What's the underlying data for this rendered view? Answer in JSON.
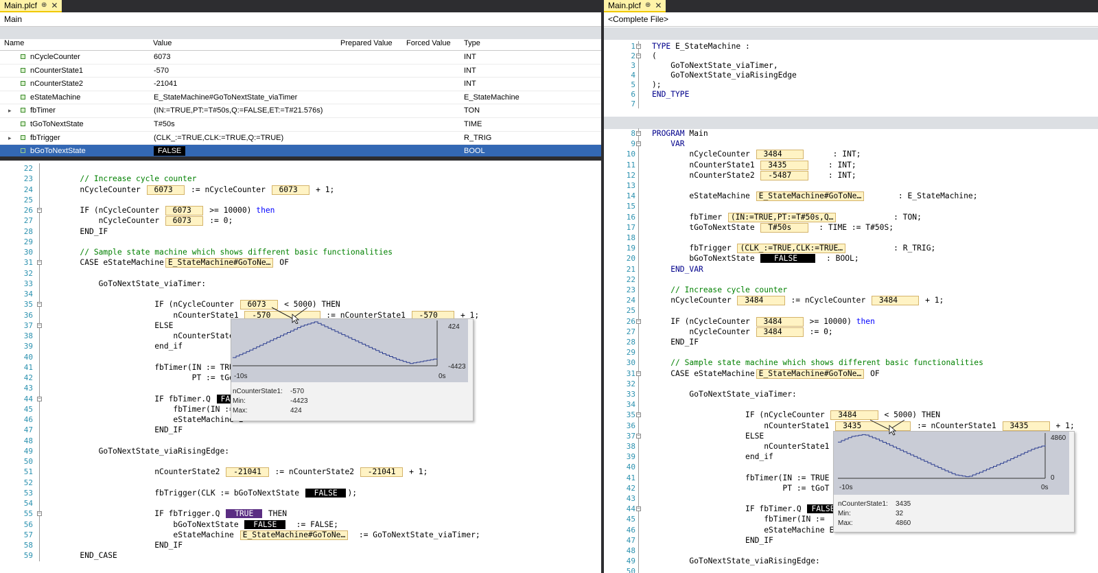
{
  "left": {
    "tab": {
      "title": "Main.plcf",
      "pin": "⊕",
      "close": "✕"
    },
    "breadcrumb": "Main",
    "watch": {
      "columns": [
        "Name",
        "Value",
        "Prepared Value",
        "Forced Value",
        "Type"
      ],
      "rows": [
        {
          "name": "nCycleCounter",
          "value": "6073",
          "type": "INT",
          "expandable": false
        },
        {
          "name": "nCounterState1",
          "value": "-570",
          "type": "INT",
          "expandable": false
        },
        {
          "name": "nCounterState2",
          "value": "-21041",
          "type": "INT",
          "expandable": false
        },
        {
          "name": "eStateMachine",
          "value": "E_StateMachine#GoToNextState_viaTimer",
          "type": "E_StateMachine",
          "expandable": false
        },
        {
          "name": "fbTimer",
          "value": "(IN:=TRUE,PT:=T#50s,Q:=FALSE,ET:=T#21.576s)",
          "type": "TON",
          "expandable": true
        },
        {
          "name": "tGoToNextState",
          "value": "T#50s",
          "type": "TIME",
          "expandable": false
        },
        {
          "name": "fbTrigger",
          "value": "(CLK_:=TRUE,CLK:=TRUE,Q:=TRUE)",
          "type": "R_TRIG",
          "expandable": true
        },
        {
          "name": "bGoToNextState",
          "value": "FALSE",
          "type": "BOOL",
          "expandable": false,
          "selected": true
        }
      ]
    },
    "code": [
      {
        "n": "22",
        "parts": []
      },
      {
        "n": "23",
        "parts": [
          {
            "c": "cm",
            "t": "        // Increase cycle counter"
          }
        ]
      },
      {
        "n": "24",
        "parts": [
          {
            "t": "        nCycleCounter "
          },
          {
            "c": "iv",
            "t": " 6073  "
          },
          {
            "t": " := nCycleCounter "
          },
          {
            "c": "iv",
            "t": " 6073  "
          },
          {
            "t": " + 1;"
          }
        ]
      },
      {
        "n": "25",
        "parts": []
      },
      {
        "n": "26",
        "fold": "-",
        "parts": [
          {
            "t": "        IF (nCycleCounter "
          },
          {
            "c": "iv",
            "t": " 6073  "
          },
          {
            "t": " >= 10000) "
          },
          {
            "c": "kw",
            "t": "then"
          }
        ]
      },
      {
        "n": "27",
        "parts": [
          {
            "t": "            nCycleCounter "
          },
          {
            "c": "iv",
            "t": " 6073  "
          },
          {
            "t": " := 0;"
          }
        ]
      },
      {
        "n": "28",
        "parts": [
          {
            "t": "        END_IF"
          }
        ]
      },
      {
        "n": "29",
        "parts": []
      },
      {
        "n": "30",
        "parts": [
          {
            "c": "cm",
            "t": "        // Sample state machine which shows different basic functionalities"
          }
        ]
      },
      {
        "n": "31",
        "fold": "-",
        "parts": [
          {
            "t": "        CASE eStateMachine"
          },
          {
            "c": "iv",
            "t": "E_StateMachine#GoToNe…"
          },
          {
            "t": " OF"
          }
        ]
      },
      {
        "n": "32",
        "parts": []
      },
      {
        "n": "33",
        "parts": [
          {
            "t": "            GoToNextState_viaTimer:"
          }
        ]
      },
      {
        "n": "34",
        "parts": []
      },
      {
        "n": "35",
        "fold": "-",
        "parts": [
          {
            "t": "                        IF (nCycleCounter "
          },
          {
            "c": "iv",
            "t": " 6073  "
          },
          {
            "t": " < 5000) THEN"
          }
        ]
      },
      {
        "n": "36",
        "parts": [
          {
            "t": "                            nCounterState1 "
          },
          {
            "c": "iv",
            "t": " -570          "
          },
          {
            "t": " := nCounterState1 "
          },
          {
            "c": "iv",
            "t": " -570   "
          },
          {
            "t": " + 1;"
          }
        ]
      },
      {
        "n": "37",
        "fold": "-",
        "parts": [
          {
            "t": "                        ELSE"
          }
        ]
      },
      {
        "n": "38",
        "parts": [
          {
            "t": "                            nCounterState1"
          }
        ]
      },
      {
        "n": "39",
        "parts": [
          {
            "t": "                        end_if"
          }
        ]
      },
      {
        "n": "40",
        "parts": []
      },
      {
        "n": "41",
        "parts": [
          {
            "t": "                        fbTimer(IN := TRUE"
          }
        ]
      },
      {
        "n": "42",
        "parts": [
          {
            "t": "                                PT := tGoT"
          }
        ]
      },
      {
        "n": "43",
        "parts": []
      },
      {
        "n": "44",
        "fold": "-",
        "parts": [
          {
            "t": "                        IF fbTimer.Q "
          },
          {
            "c": "ivb",
            "t": "FALSE"
          }
        ]
      },
      {
        "n": "45",
        "parts": [
          {
            "t": "                            fbTimer(IN :="
          }
        ]
      },
      {
        "n": "46",
        "parts": [
          {
            "t": "                            eStateMachine E"
          }
        ]
      },
      {
        "n": "47",
        "parts": [
          {
            "t": "                        END_IF"
          }
        ]
      },
      {
        "n": "48",
        "parts": []
      },
      {
        "n": "49",
        "parts": [
          {
            "t": "            GoToNextState_viaRisingEdge:"
          }
        ]
      },
      {
        "n": "50",
        "parts": []
      },
      {
        "n": "51",
        "parts": [
          {
            "t": "                        nCounterState2 "
          },
          {
            "c": "iv",
            "t": " -21041 "
          },
          {
            "t": " := nCounterState2 "
          },
          {
            "c": "iv",
            "t": " -21041 "
          },
          {
            "t": " + 1;"
          }
        ]
      },
      {
        "n": "52",
        "parts": []
      },
      {
        "n": "53",
        "parts": [
          {
            "t": "                        fbTrigger(CLK := bGoToNextState "
          },
          {
            "c": "ivb",
            "t": " FALSE "
          },
          {
            "t": ");"
          }
        ]
      },
      {
        "n": "54",
        "parts": []
      },
      {
        "n": "55",
        "fold": "-",
        "parts": [
          {
            "t": "                        IF fbTrigger.Q "
          },
          {
            "c": "ivp",
            "t": " TRUE "
          },
          {
            "t": " THEN"
          }
        ]
      },
      {
        "n": "56",
        "parts": [
          {
            "t": "                            bGoToNextState "
          },
          {
            "c": "ivb",
            "t": " FALSE "
          },
          {
            "t": "  := FALSE;"
          }
        ]
      },
      {
        "n": "57",
        "parts": [
          {
            "t": "                            eStateMachine "
          },
          {
            "c": "iv",
            "t": "E_StateMachine#GoToNe…"
          },
          {
            "t": "  := GoToNextState_viaTimer;"
          }
        ]
      },
      {
        "n": "58",
        "parts": [
          {
            "t": "                        END_IF"
          }
        ]
      },
      {
        "n": "59",
        "parts": [
          {
            "t": "        END_CASE"
          }
        ]
      }
    ],
    "tooltip": {
      "max_label": "424",
      "min_label": "-4423",
      "x_left": "-10s",
      "x_right": "0s",
      "name_label": "nCounterState1:",
      "name_value": "-570",
      "min_text": "Min:",
      "min_value": "-4423",
      "max_text": "Max:",
      "max_value": "424",
      "trace": [
        0.16,
        0.3,
        0.45,
        0.6,
        0.75,
        0.9,
        1.0,
        0.85,
        0.7,
        0.55,
        0.4,
        0.25,
        0.12,
        0.02,
        0.08,
        0.14
      ]
    }
  },
  "right": {
    "tab": {
      "title": "Main.plcf",
      "pin": "⊕",
      "close": "✕"
    },
    "breadcrumb": "<Complete File>",
    "code_a": [
      {
        "n": "1",
        "fold": "-",
        "parts": [
          {
            "c": "kwb",
            "t": "TYPE"
          },
          {
            "t": " E_StateMachine :"
          }
        ]
      },
      {
        "n": "2",
        "fold": "-",
        "parts": [
          {
            "t": "("
          }
        ]
      },
      {
        "n": "3",
        "parts": [
          {
            "t": "    GoToNextState_viaTimer,"
          }
        ]
      },
      {
        "n": "4",
        "parts": [
          {
            "t": "    GoToNextState_viaRisingEdge"
          }
        ]
      },
      {
        "n": "5",
        "parts": [
          {
            "t": ");"
          }
        ]
      },
      {
        "n": "6",
        "parts": [
          {
            "c": "kwb",
            "t": "END_TYPE"
          }
        ]
      },
      {
        "n": "7",
        "parts": []
      }
    ],
    "code_b": [
      {
        "n": "8",
        "fold": "-",
        "parts": [
          {
            "c": "kwb",
            "t": "PROGRAM"
          },
          {
            "t": " Main"
          }
        ]
      },
      {
        "n": "9",
        "fold": "-",
        "parts": [
          {
            "c": "kwb",
            "t": "    VAR"
          }
        ]
      },
      {
        "n": "10",
        "parts": [
          {
            "t": "        nCycleCounter "
          },
          {
            "c": "iv",
            "t": " 3484    "
          },
          {
            "t": "      : INT;"
          }
        ]
      },
      {
        "n": "11",
        "parts": [
          {
            "t": "        nCounterState1 "
          },
          {
            "c": "iv",
            "t": " 3435    "
          },
          {
            "t": "    : INT;"
          }
        ]
      },
      {
        "n": "12",
        "parts": [
          {
            "t": "        nCounterState2 "
          },
          {
            "c": "iv",
            "t": " -5487   "
          },
          {
            "t": "    : INT;"
          }
        ]
      },
      {
        "n": "13",
        "parts": []
      },
      {
        "n": "14",
        "parts": [
          {
            "t": "        eStateMachine "
          },
          {
            "c": "iv",
            "t": "E_StateMachine#GoToNe…"
          },
          {
            "t": "       : E_StateMachine;"
          }
        ]
      },
      {
        "n": "15",
        "parts": []
      },
      {
        "n": "16",
        "parts": [
          {
            "t": "        fbTimer "
          },
          {
            "c": "iv",
            "t": "(IN:=TRUE,PT:=T#50s,Q…"
          },
          {
            "t": "            : TON;"
          }
        ]
      },
      {
        "n": "17",
        "parts": [
          {
            "t": "        tGoToNextState "
          },
          {
            "c": "iv",
            "t": " T#50s   "
          },
          {
            "t": "  : TIME := T#50S;"
          }
        ]
      },
      {
        "n": "18",
        "parts": []
      },
      {
        "n": "19",
        "parts": [
          {
            "t": "        fbTrigger "
          },
          {
            "c": "iv",
            "t": "(CLK_:=TRUE,CLK:=TRUE…"
          },
          {
            "t": "          : R_TRIG;"
          }
        ]
      },
      {
        "n": "20",
        "parts": [
          {
            "t": "        bGoToNextState "
          },
          {
            "c": "ivb",
            "t": "  FALSE   "
          },
          {
            "t": "  : BOOL;"
          }
        ]
      },
      {
        "n": "21",
        "parts": [
          {
            "c": "kwb",
            "t": "    END_VAR"
          }
        ]
      },
      {
        "n": "22",
        "parts": []
      },
      {
        "n": "23",
        "parts": [
          {
            "c": "cm",
            "t": "    // Increase cycle counter"
          }
        ]
      },
      {
        "n": "24",
        "parts": [
          {
            "t": "    nCycleCounter "
          },
          {
            "c": "iv",
            "t": " 3484    "
          },
          {
            "t": " := nCycleCounter "
          },
          {
            "c": "iv",
            "t": " 3484    "
          },
          {
            "t": " + 1;"
          }
        ]
      },
      {
        "n": "25",
        "parts": []
      },
      {
        "n": "26",
        "fold": "-",
        "parts": [
          {
            "t": "    IF (nCycleCounter "
          },
          {
            "c": "iv",
            "t": " 3484    "
          },
          {
            "t": " >= 10000) "
          },
          {
            "c": "kw",
            "t": "then"
          }
        ]
      },
      {
        "n": "27",
        "parts": [
          {
            "t": "        nCycleCounter "
          },
          {
            "c": "iv",
            "t": " 3484    "
          },
          {
            "t": " := 0;"
          }
        ]
      },
      {
        "n": "28",
        "parts": [
          {
            "t": "    END_IF"
          }
        ]
      },
      {
        "n": "29",
        "parts": []
      },
      {
        "n": "30",
        "parts": [
          {
            "c": "cm",
            "t": "    // Sample state machine which shows different basic functionalities"
          }
        ]
      },
      {
        "n": "31",
        "fold": "-",
        "parts": [
          {
            "t": "    CASE eStateMachine"
          },
          {
            "c": "iv",
            "t": "E_StateMachine#GoToNe…"
          },
          {
            "t": " OF"
          }
        ]
      },
      {
        "n": "32",
        "parts": []
      },
      {
        "n": "33",
        "parts": [
          {
            "t": "        GoToNextState_viaTimer:"
          }
        ]
      },
      {
        "n": "34",
        "parts": []
      },
      {
        "n": "35",
        "fold": "-",
        "parts": [
          {
            "t": "                    IF (nCycleCounter "
          },
          {
            "c": "iv",
            "t": " 3484    "
          },
          {
            "t": " < 5000) THEN"
          }
        ]
      },
      {
        "n": "36",
        "parts": [
          {
            "t": "                        nCounterState1 "
          },
          {
            "c": "iv",
            "t": " 3435          "
          },
          {
            "t": " := nCounterState1 "
          },
          {
            "c": "iv",
            "t": " 3435    "
          },
          {
            "t": " + 1;"
          }
        ]
      },
      {
        "n": "37",
        "fold": "-",
        "parts": [
          {
            "t": "                    ELSE"
          }
        ]
      },
      {
        "n": "38",
        "parts": [
          {
            "t": "                        nCounterState1"
          }
        ]
      },
      {
        "n": "39",
        "parts": [
          {
            "t": "                    end_if"
          }
        ]
      },
      {
        "n": "40",
        "parts": []
      },
      {
        "n": "41",
        "parts": [
          {
            "t": "                    fbTimer(IN := TRUE"
          }
        ]
      },
      {
        "n": "42",
        "parts": [
          {
            "t": "                            PT := tGoT"
          }
        ]
      },
      {
        "n": "43",
        "parts": []
      },
      {
        "n": "44",
        "fold": "-",
        "parts": [
          {
            "t": "                    IF fbTimer.Q "
          },
          {
            "c": "ivb",
            "t": "FALSE"
          }
        ]
      },
      {
        "n": "45",
        "parts": [
          {
            "t": "                        fbTimer(IN :="
          }
        ]
      },
      {
        "n": "46",
        "parts": [
          {
            "t": "                        eStateMachine E"
          }
        ]
      },
      {
        "n": "47",
        "parts": [
          {
            "t": "                    END_IF"
          }
        ]
      },
      {
        "n": "48",
        "parts": []
      },
      {
        "n": "49",
        "parts": [
          {
            "t": "        GoToNextState_viaRisingEdge:"
          }
        ]
      },
      {
        "n": "50",
        "parts": []
      }
    ],
    "tooltip": {
      "max_label": "4860",
      "min_label": "0",
      "x_left": "-10s",
      "x_right": "0s",
      "name_label": "nCounterState1:",
      "name_value": "3435",
      "min_text": "Min:",
      "min_value": "32",
      "max_text": "Max:",
      "max_value": "4860",
      "trace": [
        0.82,
        0.95,
        1.0,
        0.88,
        0.74,
        0.6,
        0.46,
        0.32,
        0.18,
        0.05,
        0.0,
        0.12,
        0.25,
        0.38,
        0.52,
        0.66,
        0.75
      ]
    }
  },
  "colors": {
    "selection": "#3368b4",
    "inline_value_bg": "#fff3c4",
    "bool_true_bg": "#5a2d82",
    "comment": "#008000"
  }
}
